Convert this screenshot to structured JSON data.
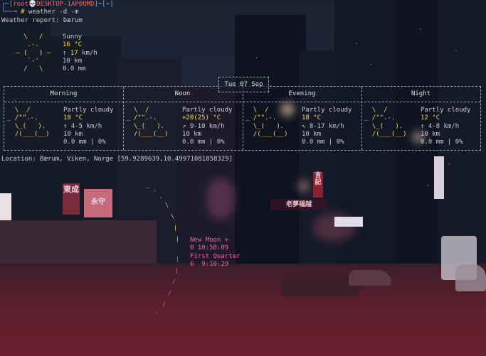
{
  "prompt": {
    "user": "root",
    "skull": "💀",
    "host": "DESKTOP-1AP0OMD",
    "path": "~",
    "hash": "#",
    "command": "weather -d -m"
  },
  "report_title": "Weather report: bærum",
  "current": {
    "condition": "Sunny",
    "temperature": "16 °C",
    "wind_arrow": "↑",
    "wind_value": "17",
    "wind_unit": "km/h",
    "visibility": "10 km",
    "precipitation": "0.0 mm",
    "art": [
      "   \\   /",
      "    .-.",
      " ― (   ) ―",
      "    `-'",
      "   /   \\"
    ]
  },
  "date_label": "Tue 07 Sep",
  "periods": [
    {
      "name": "Morning",
      "condition": "Partly cloudy",
      "temperature": "18 °C",
      "wind": "↑ 4-5 km/h",
      "visibility": "10 km",
      "precip": "0.0 mm | 0%"
    },
    {
      "name": "Noon",
      "condition": "Partly cloudy",
      "temperature": "+20(25) °C",
      "wind": "↗ 9-10 km/h",
      "visibility": "10 km",
      "precip": "0.0 mm | 0%"
    },
    {
      "name": "Evening",
      "condition": "Partly cloudy",
      "temperature": "18 °C",
      "wind": "↖ 8-17 km/h",
      "visibility": "10 km",
      "precip": "0.0 mm | 0%"
    },
    {
      "name": "Night",
      "condition": "Partly cloudy",
      "temperature": "12 °C",
      "wind": "↑ 4-8 km/h",
      "visibility": "10 km",
      "precip": "0.0 mm | 0%"
    }
  ],
  "cloud_art": [
    "  \\  /",
    "_ /\"\".-.",
    "  \\_(   ).",
    "  /(___(__)"
  ],
  "location": "Location: Bærum, Viken, Norge [59.9289639,10.4997108185​8329]",
  "moon": {
    "line1": "New Moon +",
    "line2": "0 10:58:09",
    "line3": "First Quarter",
    "line4": "6  9:10:29"
  },
  "signs": [
    "東成",
    "永守",
    "言記",
    "老夢福越"
  ],
  "colors": {
    "accent": "#ffd84a",
    "prompt_red": "#ff5f5f",
    "moon_pink": "#ff5fae",
    "border": "#8fb59a"
  }
}
